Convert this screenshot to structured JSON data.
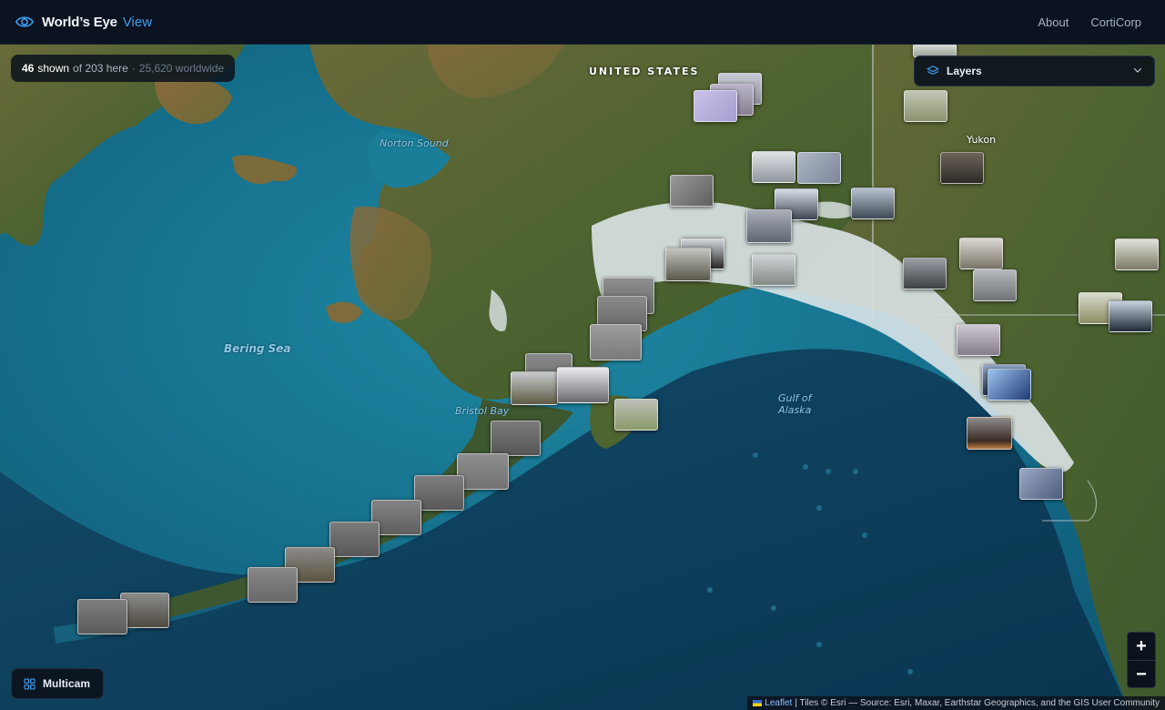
{
  "app": {
    "name": "World’s Eye",
    "view": "View",
    "nav": {
      "about": "About",
      "corticorp": "CortiCorp"
    }
  },
  "counter": {
    "shown": "46",
    "shown_label": "shown",
    "of_text": "of 203 here",
    "separator": "·",
    "worldwide": "25,620 worldwide"
  },
  "layers": {
    "label": "Layers",
    "icon": "layers-icon"
  },
  "multicam": {
    "label": "Multicam",
    "icon": "grid-icon"
  },
  "zoom": {
    "in": "+",
    "out": "−"
  },
  "attribution": {
    "leaflet": "Leaflet",
    "text": "| Tiles © Esri — Source: Esri, Maxar, Earthstar Geographics, and the GIS User Community"
  },
  "map_labels": {
    "united_states": "UNITED STATES",
    "yukon": "Yukon",
    "norton_sound": "Norton Sound",
    "bering_sea": "Bering Sea",
    "bristol_bay": "Bristol Bay",
    "gulf_line1": "Gulf of",
    "gulf_line2": "Alaska"
  },
  "colors": {
    "accent": "#3b9cf0",
    "topbar": "#0b1220",
    "ocean": "#136a86",
    "deep_ocean": "#0e3d58",
    "land": "#5b6a35",
    "snow": "#e8eef0"
  }
}
